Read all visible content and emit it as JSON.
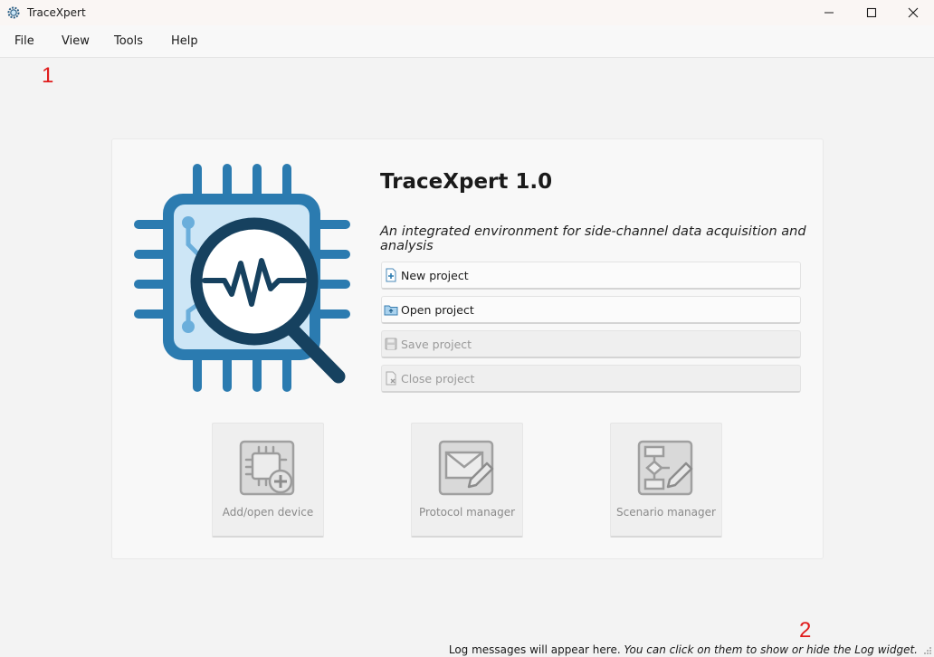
{
  "window": {
    "title": "TraceXpert",
    "icon": "gear-chip-icon"
  },
  "menu": {
    "items": [
      "File",
      "View",
      "Tools",
      "Help"
    ]
  },
  "markers": {
    "first": "1",
    "second": "2"
  },
  "welcome": {
    "app_name": "TraceXpert 1.0",
    "tagline": "An integrated environment for side-channel data acquisition and analysis",
    "project_buttons": [
      {
        "label": "New project",
        "icon": "new-project-icon",
        "enabled": true
      },
      {
        "label": "Open project",
        "icon": "open-folder-icon",
        "enabled": true
      },
      {
        "label": "Save project",
        "icon": "save-icon",
        "enabled": false
      },
      {
        "label": "Close project",
        "icon": "close-project-icon",
        "enabled": false
      }
    ],
    "tiles": [
      {
        "label": "Add/open device",
        "icon": "chip-add-icon"
      },
      {
        "label": "Protocol manager",
        "icon": "envelope-edit-icon"
      },
      {
        "label": "Scenario manager",
        "icon": "flowchart-edit-icon"
      }
    ]
  },
  "status": {
    "prefix": "Log messages will appear here.",
    "hint": "You can click on them to show or hide the Log widget."
  },
  "colors": {
    "chip_blue": "#2b7bb0",
    "chip_light": "#cde6f6",
    "lens_dark": "#16415f",
    "marker_red": "#e01b1b"
  }
}
